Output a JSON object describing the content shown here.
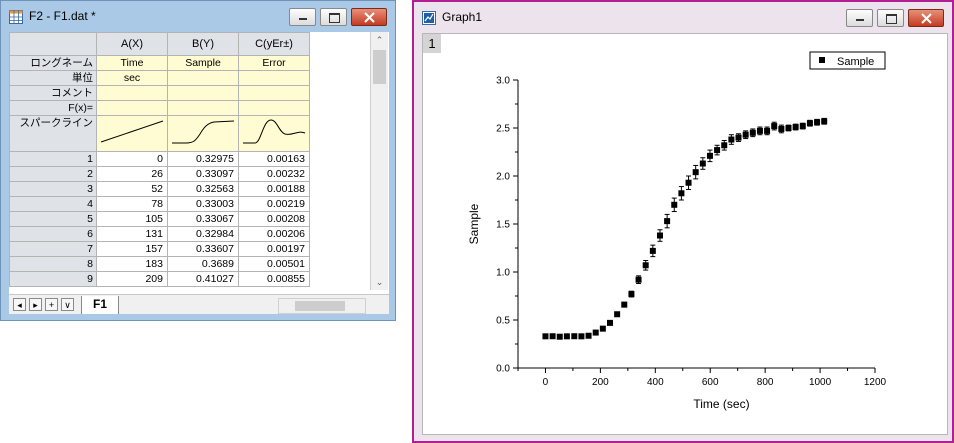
{
  "worksheet": {
    "title": "F2 - F1.dat *",
    "columns": [
      "A(X)",
      "B(Y)",
      "C(yEr±)"
    ],
    "meta_rows": [
      {
        "label": "ロングネーム",
        "values": [
          "Time",
          "Sample",
          "Error"
        ]
      },
      {
        "label": "単位",
        "values": [
          "sec",
          "",
          ""
        ]
      },
      {
        "label": "コメント",
        "values": [
          "",
          "",
          ""
        ]
      },
      {
        "label": "F(x)=",
        "values": [
          "",
          "",
          ""
        ]
      }
    ],
    "sparkline_label": "スパークライン",
    "rows": [
      {
        "n": "1",
        "a": "0",
        "b": "0.32975",
        "c": "0.00163"
      },
      {
        "n": "2",
        "a": "26",
        "b": "0.33097",
        "c": "0.00232"
      },
      {
        "n": "3",
        "a": "52",
        "b": "0.32563",
        "c": "0.00188"
      },
      {
        "n": "4",
        "a": "78",
        "b": "0.33003",
        "c": "0.00219"
      },
      {
        "n": "5",
        "a": "105",
        "b": "0.33067",
        "c": "0.00208"
      },
      {
        "n": "6",
        "a": "131",
        "b": "0.32984",
        "c": "0.00206"
      },
      {
        "n": "7",
        "a": "157",
        "b": "0.33607",
        "c": "0.00197"
      },
      {
        "n": "8",
        "a": "183",
        "b": "0.3689",
        "c": "0.00501"
      },
      {
        "n": "9",
        "a": "209",
        "b": "0.41027",
        "c": "0.00855"
      }
    ],
    "sheet_tab": "F1",
    "nav_buttons": [
      "◂",
      "▸",
      "+",
      "∨"
    ]
  },
  "graph": {
    "title": "Graph1",
    "layer": "1"
  },
  "colors": {
    "graph_border": "#b21f95",
    "worksheet_frame": "#a9c9e6",
    "meta_fill": "#fffbd2",
    "header_fill": "#dfe3e8"
  },
  "chart_data": {
    "type": "scatter",
    "xlabel": "Time (sec)",
    "ylabel": "Sample",
    "xlim": [
      -100,
      1200
    ],
    "ylim": [
      0.0,
      3.0
    ],
    "xticks": [
      0,
      200,
      400,
      600,
      800,
      1000,
      1200
    ],
    "yticks": [
      0.0,
      0.5,
      1.0,
      1.5,
      2.0,
      2.5,
      3.0
    ],
    "x_tick_labels": [
      "0",
      "200",
      "400",
      "600",
      "800",
      "1000",
      "1200"
    ],
    "y_tick_labels": [
      "0.0",
      "0.5",
      "1.0",
      "1.5",
      "2.0",
      "2.5",
      "3.0"
    ],
    "legend": {
      "position": "top-right",
      "entries": [
        "Sample"
      ]
    },
    "series": [
      {
        "name": "Sample",
        "marker": "square",
        "x": [
          0,
          26,
          52,
          78,
          105,
          131,
          157,
          183,
          209,
          235,
          261,
          287,
          313,
          339,
          365,
          391,
          417,
          443,
          469,
          495,
          521,
          547,
          573,
          599,
          625,
          651,
          677,
          703,
          729,
          755,
          781,
          807,
          833,
          859,
          885,
          911,
          937,
          963,
          989,
          1015
        ],
        "y": [
          0.33,
          0.331,
          0.326,
          0.33,
          0.331,
          0.33,
          0.336,
          0.369,
          0.41,
          0.47,
          0.56,
          0.66,
          0.77,
          0.92,
          1.07,
          1.22,
          1.38,
          1.53,
          1.7,
          1.82,
          1.93,
          2.04,
          2.13,
          2.21,
          2.27,
          2.32,
          2.38,
          2.4,
          2.43,
          2.45,
          2.47,
          2.47,
          2.52,
          2.49,
          2.5,
          2.51,
          2.52,
          2.55,
          2.56,
          2.57
        ],
        "error": [
          0.002,
          0.002,
          0.002,
          0.002,
          0.002,
          0.002,
          0.002,
          0.005,
          0.009,
          0.012,
          0.018,
          0.024,
          0.03,
          0.04,
          0.05,
          0.06,
          0.06,
          0.07,
          0.07,
          0.07,
          0.07,
          0.07,
          0.06,
          0.06,
          0.05,
          0.05,
          0.05,
          0.04,
          0.04,
          0.04,
          0.04,
          0.04,
          0.04,
          0.04,
          0.03,
          0.03,
          0.03,
          0.03,
          0.03,
          0.03
        ]
      }
    ]
  }
}
